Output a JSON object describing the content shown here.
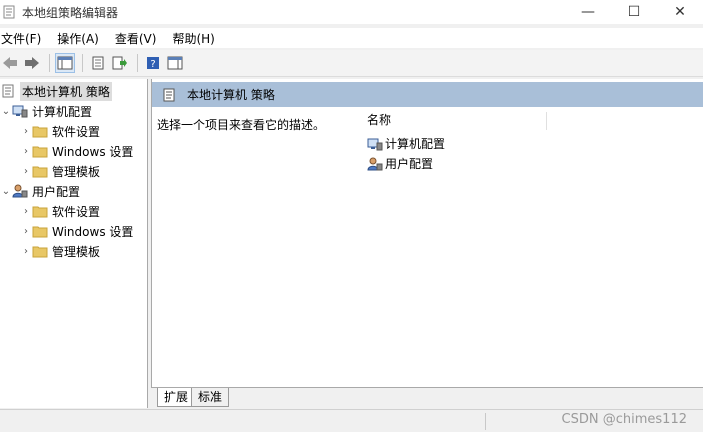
{
  "window": {
    "title": "本地组策略编辑器"
  },
  "window_buttons": {
    "minimize": "—",
    "maximize": "☐",
    "close": "✕"
  },
  "menu": [
    "文件(F)",
    "操作(A)",
    "查看(V)",
    "帮助(H)"
  ],
  "toolbar": [
    "back-arrow-icon",
    "forward-arrow-icon",
    "show-tree-icon",
    "properties-icon",
    "export-list-icon",
    "help-icon",
    "show-action-pane-icon"
  ],
  "tree": {
    "root": "本地计算机 策略",
    "computer": {
      "label": "计算机配置",
      "children": [
        "软件设置",
        "Windows 设置",
        "管理模板"
      ]
    },
    "user": {
      "label": "用户配置",
      "children": [
        "软件设置",
        "Windows 设置",
        "管理模板"
      ]
    }
  },
  "right": {
    "header": "本地计算机 策略",
    "description": "选择一个项目来查看它的描述。",
    "column_name": "名称",
    "items": [
      "计算机配置",
      "用户配置"
    ]
  },
  "tabs": [
    "扩展",
    "标准"
  ],
  "watermark": "CSDN @chimes112",
  "colors": {
    "header_bar": "#a9bfd8",
    "selection": "#dddddd",
    "folder": "#e8c766"
  }
}
